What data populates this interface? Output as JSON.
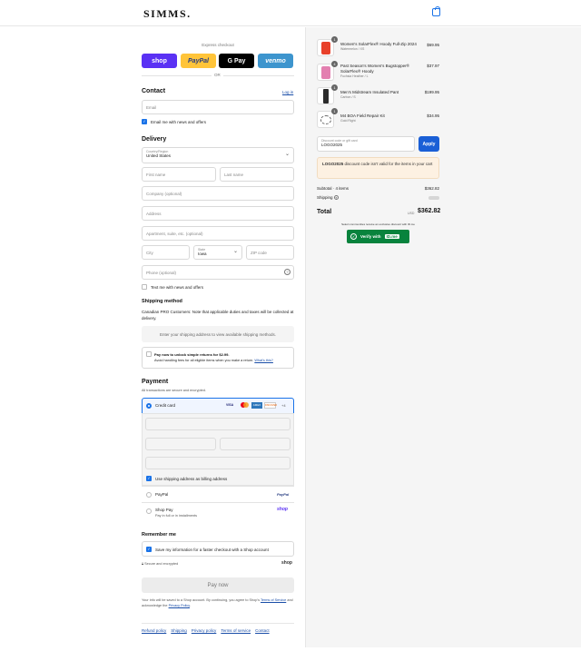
{
  "header": {
    "brand": "SIMMS."
  },
  "express": {
    "label": "Express checkout",
    "buttons": [
      {
        "label": "shop",
        "color": "#5a31f4"
      },
      {
        "label": "PayPal",
        "color": "#ffc439"
      },
      {
        "label": "G Pay",
        "color": "#000000"
      },
      {
        "label": "venmo",
        "color": "#3d95ce"
      }
    ],
    "or": "OR"
  },
  "contact": {
    "title": "Contact",
    "login": "Log in",
    "email_placeholder": "Email",
    "news": "Email me with news and offers"
  },
  "delivery": {
    "title": "Delivery",
    "country_label": "Country/Region",
    "country": "United States",
    "first": "First name",
    "last": "Last name",
    "company": "Company (optional)",
    "address": "Address",
    "apt": "Apartment, suite, etc. (optional)",
    "city": "City",
    "state_label": "State",
    "state": "Iowa",
    "zip": "ZIP code",
    "phone": "Phone (optional)",
    "text_news": "Text me with news and offers"
  },
  "shipping_method": {
    "title": "Shipping method",
    "note": "Canadian PRO Customers: Note that applicable duties and taxes will be collected at delivery.",
    "placeholder": "Enter your shipping address to view available shipping methods.",
    "returns_title": "Pay now to unlock simple returns for $2.99.",
    "returns_sub": "Avoid handling fees for all eligible items when you make a return.",
    "returns_link": "What's this?"
  },
  "payment": {
    "title": "Payment",
    "sub": "All transactions are secure and encrypted.",
    "credit_card": "Credit card",
    "card_brands": [
      "VISA",
      "MC",
      "AMEX",
      "DISCOVER",
      "+4"
    ],
    "billing": "Use shipping address as billing address",
    "paypal": "PayPal",
    "paypal_logo": "PayPal",
    "shoppay": "Shop Pay",
    "shoppay_sub": "Pay in full or in installments",
    "shoppay_logo": "shop"
  },
  "remember": {
    "title": "Remember me",
    "save": "Save my information for a faster checkout with a Shop account",
    "secure": "Secure and encrypted",
    "shop_logo": "shop"
  },
  "pay_now": "Pay now",
  "legal": {
    "text1": "Your info will be saved to a Shop account. By continuing, you agree to Shop's",
    "tos": "Terms of Service",
    "and": "and acknowledge the",
    "privacy": "Privacy Policy",
    "end": "."
  },
  "footer": [
    "Refund policy",
    "Shipping",
    "Privacy policy",
    "Terms of service",
    "Contact"
  ],
  "cart": {
    "items": [
      {
        "qty": "1",
        "name": "Women's SolarFlex® Hoody Full-Zip 2024",
        "variant": "Watermelon / XS",
        "price": "$69.95",
        "color": "#e8402a"
      },
      {
        "qty": "4",
        "name": "Past Season's Women's Bugstopper® SolarFlex® Hoody",
        "variant": "Fuchsia Heather / L",
        "price": "$37.97",
        "color": "#e37fb0"
      },
      {
        "qty": "1",
        "name": "Men's Midstream Insulated Pant",
        "variant": "Carbon / S",
        "price": "$199.95",
        "color": "#2b2b2b"
      },
      {
        "qty": "1",
        "name": "M4 BOA Field Repair Kit",
        "variant": "Gold Right",
        "price": "$34.95",
        "color": "#666666"
      }
    ],
    "discount_label": "Discount code or gift card",
    "discount_value": "LOGO2025",
    "apply": "Apply",
    "error_code": "LOGO2025",
    "error_text": " discount code isn't valid for the items in your cart",
    "subtotal_label": "Subtotal · 4 items",
    "subtotal": "$362.82",
    "shipping_label": "Shipping",
    "total_label": "Total",
    "currency": "USD",
    "total": "$362.82",
    "idme_note": "Select communities receive an exclusive discount with ID.me",
    "idme_btn": "Verify with",
    "idme_logo": "ID.me"
  }
}
